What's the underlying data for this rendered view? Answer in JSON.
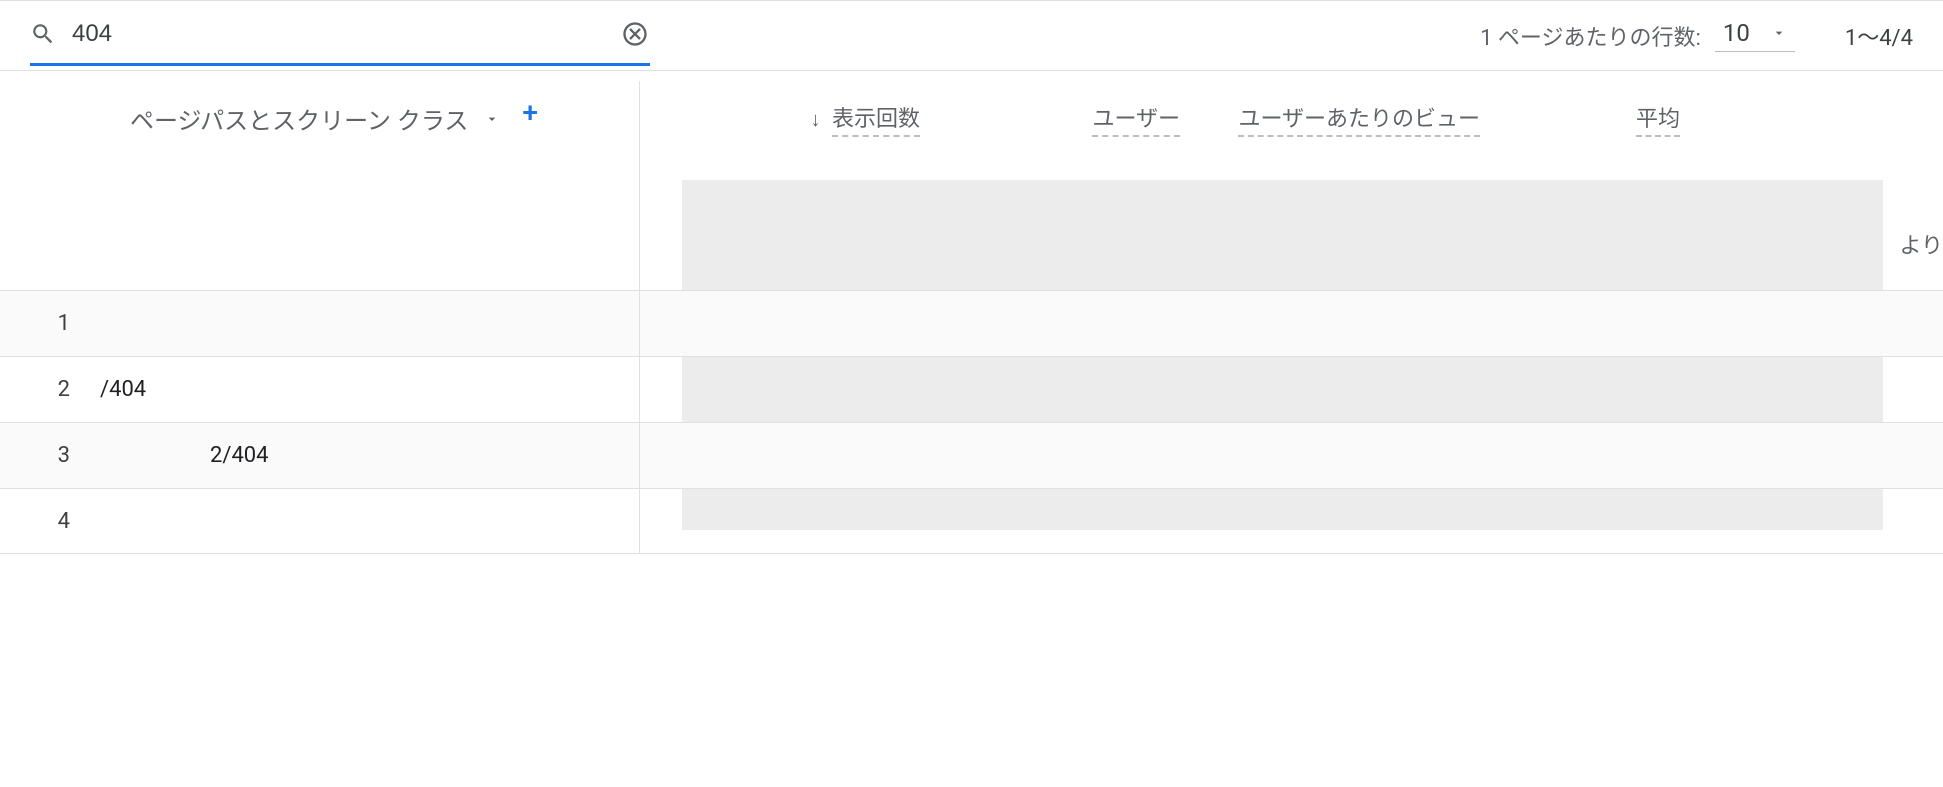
{
  "search": {
    "value": "404"
  },
  "pagination": {
    "rows_per_page_label": "1 ページあたりの行数:",
    "rows_per_page_value": "10",
    "range": "1〜4/4"
  },
  "columns": {
    "dimension_label": "ページパスとスクリーン クラス",
    "add_button": "+",
    "metrics": [
      "表示回数",
      "ユーザー",
      "ユーザーあたりのビュー",
      "平均"
    ],
    "partial_suffix": "より"
  },
  "rows": [
    {
      "num": "1",
      "path": ""
    },
    {
      "num": "2",
      "path": "/404"
    },
    {
      "num": "3",
      "path": "2/404"
    },
    {
      "num": "4",
      "path": ""
    }
  ]
}
